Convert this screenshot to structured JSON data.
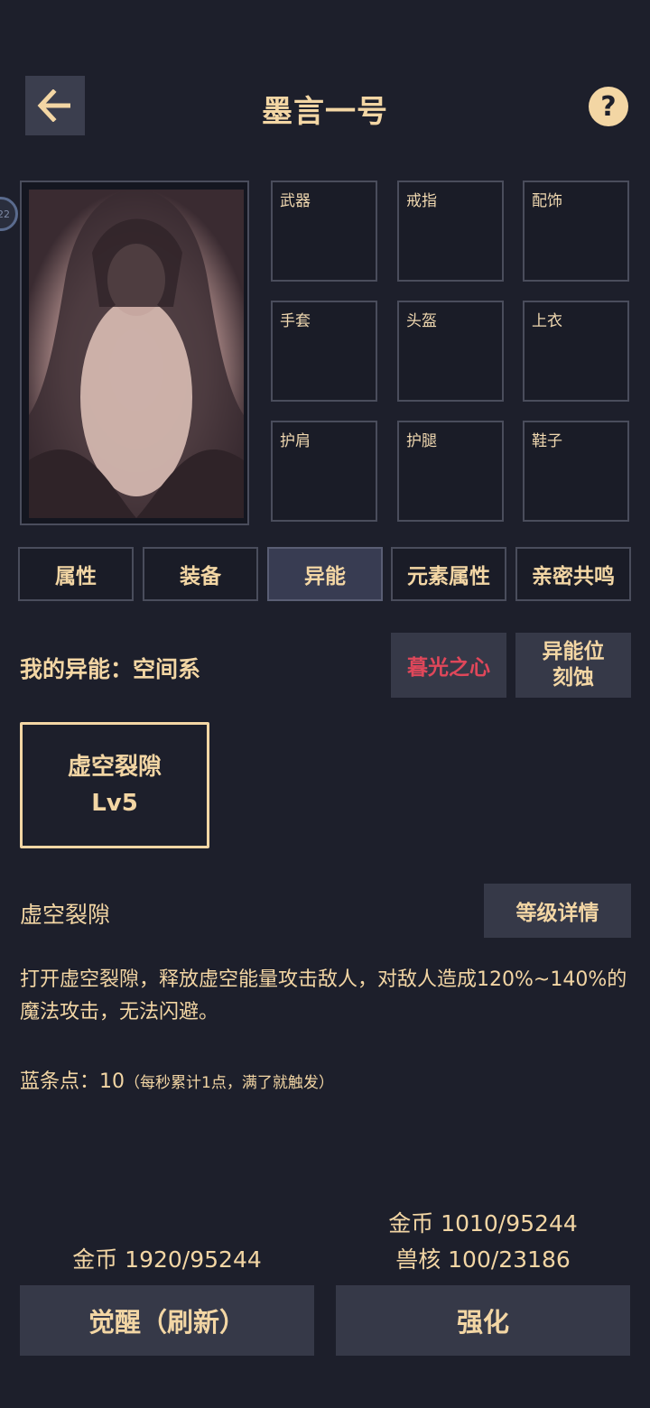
{
  "header": {
    "title": "墨言一号",
    "back_icon": "arrow-left-icon",
    "help_label": "?",
    "side_badge": "22"
  },
  "equipment_slots": [
    "武器",
    "戒指",
    "配饰",
    "手套",
    "头盔",
    "上衣",
    "护肩",
    "护腿",
    "鞋子"
  ],
  "tabs": [
    {
      "label": "属性",
      "active": false
    },
    {
      "label": "装备",
      "active": false
    },
    {
      "label": "异能",
      "active": true
    },
    {
      "label": "元素属性",
      "active": false
    },
    {
      "label": "亲密共鸣",
      "active": false
    }
  ],
  "ability": {
    "my_ability_label": "我的异能：空间系",
    "dusk_button": "暮光之心",
    "engrave_line1": "异能位",
    "engrave_line2": "刻蚀",
    "skill_card_name": "虚空裂隙",
    "skill_card_level": "Lv5",
    "skill_name": "虚空裂隙",
    "level_detail_button": "等级详情",
    "description": "打开虚空裂隙，释放虚空能量攻击敌人，对敌人造成120%~140%的魔法攻击，无法闪避。",
    "mana_label": "蓝条点：10",
    "mana_note": "（每秒累计1点，满了就触发）"
  },
  "costs": {
    "awaken_gold": "金币 1920/95244",
    "enhance_gold": "金币 1010/95244",
    "enhance_core": "兽核 100/23186"
  },
  "actions": {
    "awaken_button": "觉醒（刷新）",
    "enhance_button": "强化"
  },
  "colors": {
    "background": "#1d1f2b",
    "text": "#f3d6a4",
    "accent_red": "#e0475a",
    "button": "#363948"
  }
}
